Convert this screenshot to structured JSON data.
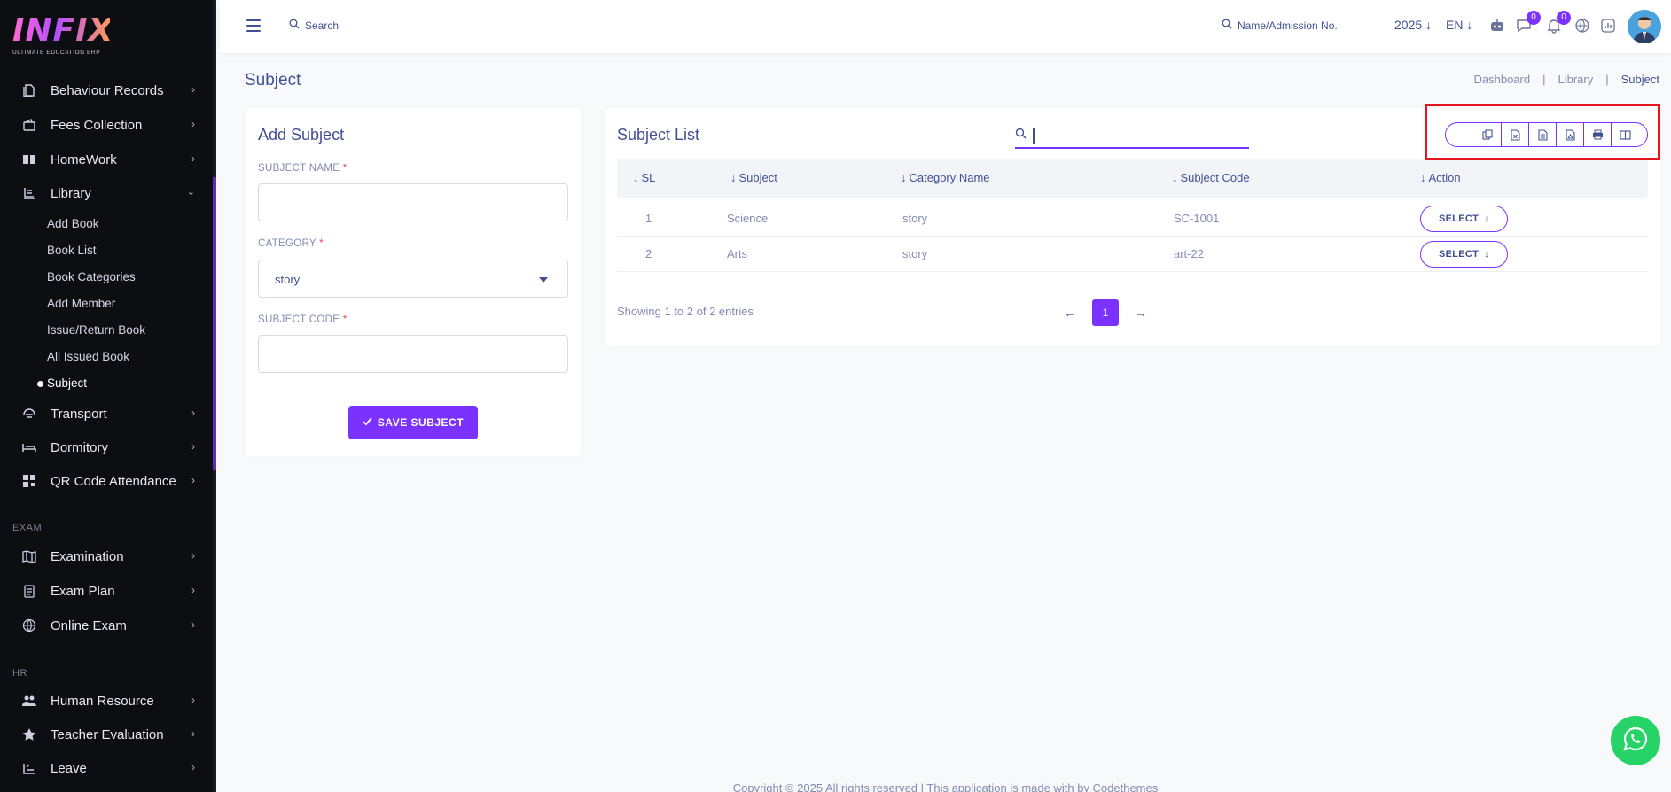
{
  "brand": {
    "logo_text": "INFIX",
    "tagline": "ULTIMATE EDUCATION ERP"
  },
  "sidebar": {
    "items": [
      {
        "label": "Behaviour Records",
        "icon": "file-icon"
      },
      {
        "label": "Fees Collection",
        "icon": "wallet-icon"
      },
      {
        "label": "HomeWork",
        "icon": "book-open-icon"
      },
      {
        "label": "Library",
        "icon": "library-icon",
        "expanded": true
      },
      {
        "label": "Transport",
        "icon": "bus-icon"
      },
      {
        "label": "Dormitory",
        "icon": "bed-icon"
      },
      {
        "label": "QR Code Attendance",
        "icon": "qr-icon"
      },
      {
        "label": "Examination",
        "icon": "map-icon"
      },
      {
        "label": "Exam Plan",
        "icon": "clipboard-icon"
      },
      {
        "label": "Online Exam",
        "icon": "globe-icon"
      },
      {
        "label": "Human Resource",
        "icon": "users-icon"
      },
      {
        "label": "Teacher Evaluation",
        "icon": "star-icon"
      },
      {
        "label": "Leave",
        "icon": "leave-icon"
      }
    ],
    "library_sub": [
      "Add Book",
      "Book List",
      "Book Categories",
      "Add Member",
      "Issue/Return Book",
      "All Issued Book",
      "Subject"
    ],
    "sections": {
      "exam": "EXAM",
      "hr": "HR"
    }
  },
  "header": {
    "search_label": "Search",
    "student_search_label": "Name/Admission No.",
    "year": "2025",
    "language": "EN",
    "chat_badge": "0",
    "notification_badge": "0"
  },
  "page": {
    "title": "Subject",
    "breadcrumb": [
      "Dashboard",
      "Library",
      "Subject"
    ]
  },
  "add_form": {
    "title": "Add Subject",
    "subject_name_label": "SUBJECT NAME",
    "category_label": "CATEGORY",
    "category_value": "story",
    "subject_code_label": "SUBJECT CODE",
    "required_mark": "*",
    "save_label": "SAVE SUBJECT"
  },
  "list": {
    "title": "Subject List",
    "columns": [
      "SL",
      "Subject",
      "Category Name",
      "Subject Code",
      "Action"
    ],
    "rows": [
      {
        "sl": "1",
        "subject": "Science",
        "category": "story",
        "code": "SC-1001",
        "action": "SELECT"
      },
      {
        "sl": "2",
        "subject": "Arts",
        "category": "story",
        "code": "art-22",
        "action": "SELECT"
      }
    ],
    "showing": "Showing 1 to 2 of 2 entries",
    "current_page": "1"
  },
  "export_buttons": [
    "copy-icon",
    "excel-icon",
    "csv-icon",
    "pdf-icon",
    "print-icon",
    "columns-icon"
  ],
  "footer": "Copyright © 2025 All rights reserved | This application is made with by Codethemes",
  "colors": {
    "accent": "#7c32ff",
    "sidebar_bg": "#0d0e12",
    "text": "#415094",
    "highlight": "#e6141e",
    "whatsapp": "#25d366"
  }
}
